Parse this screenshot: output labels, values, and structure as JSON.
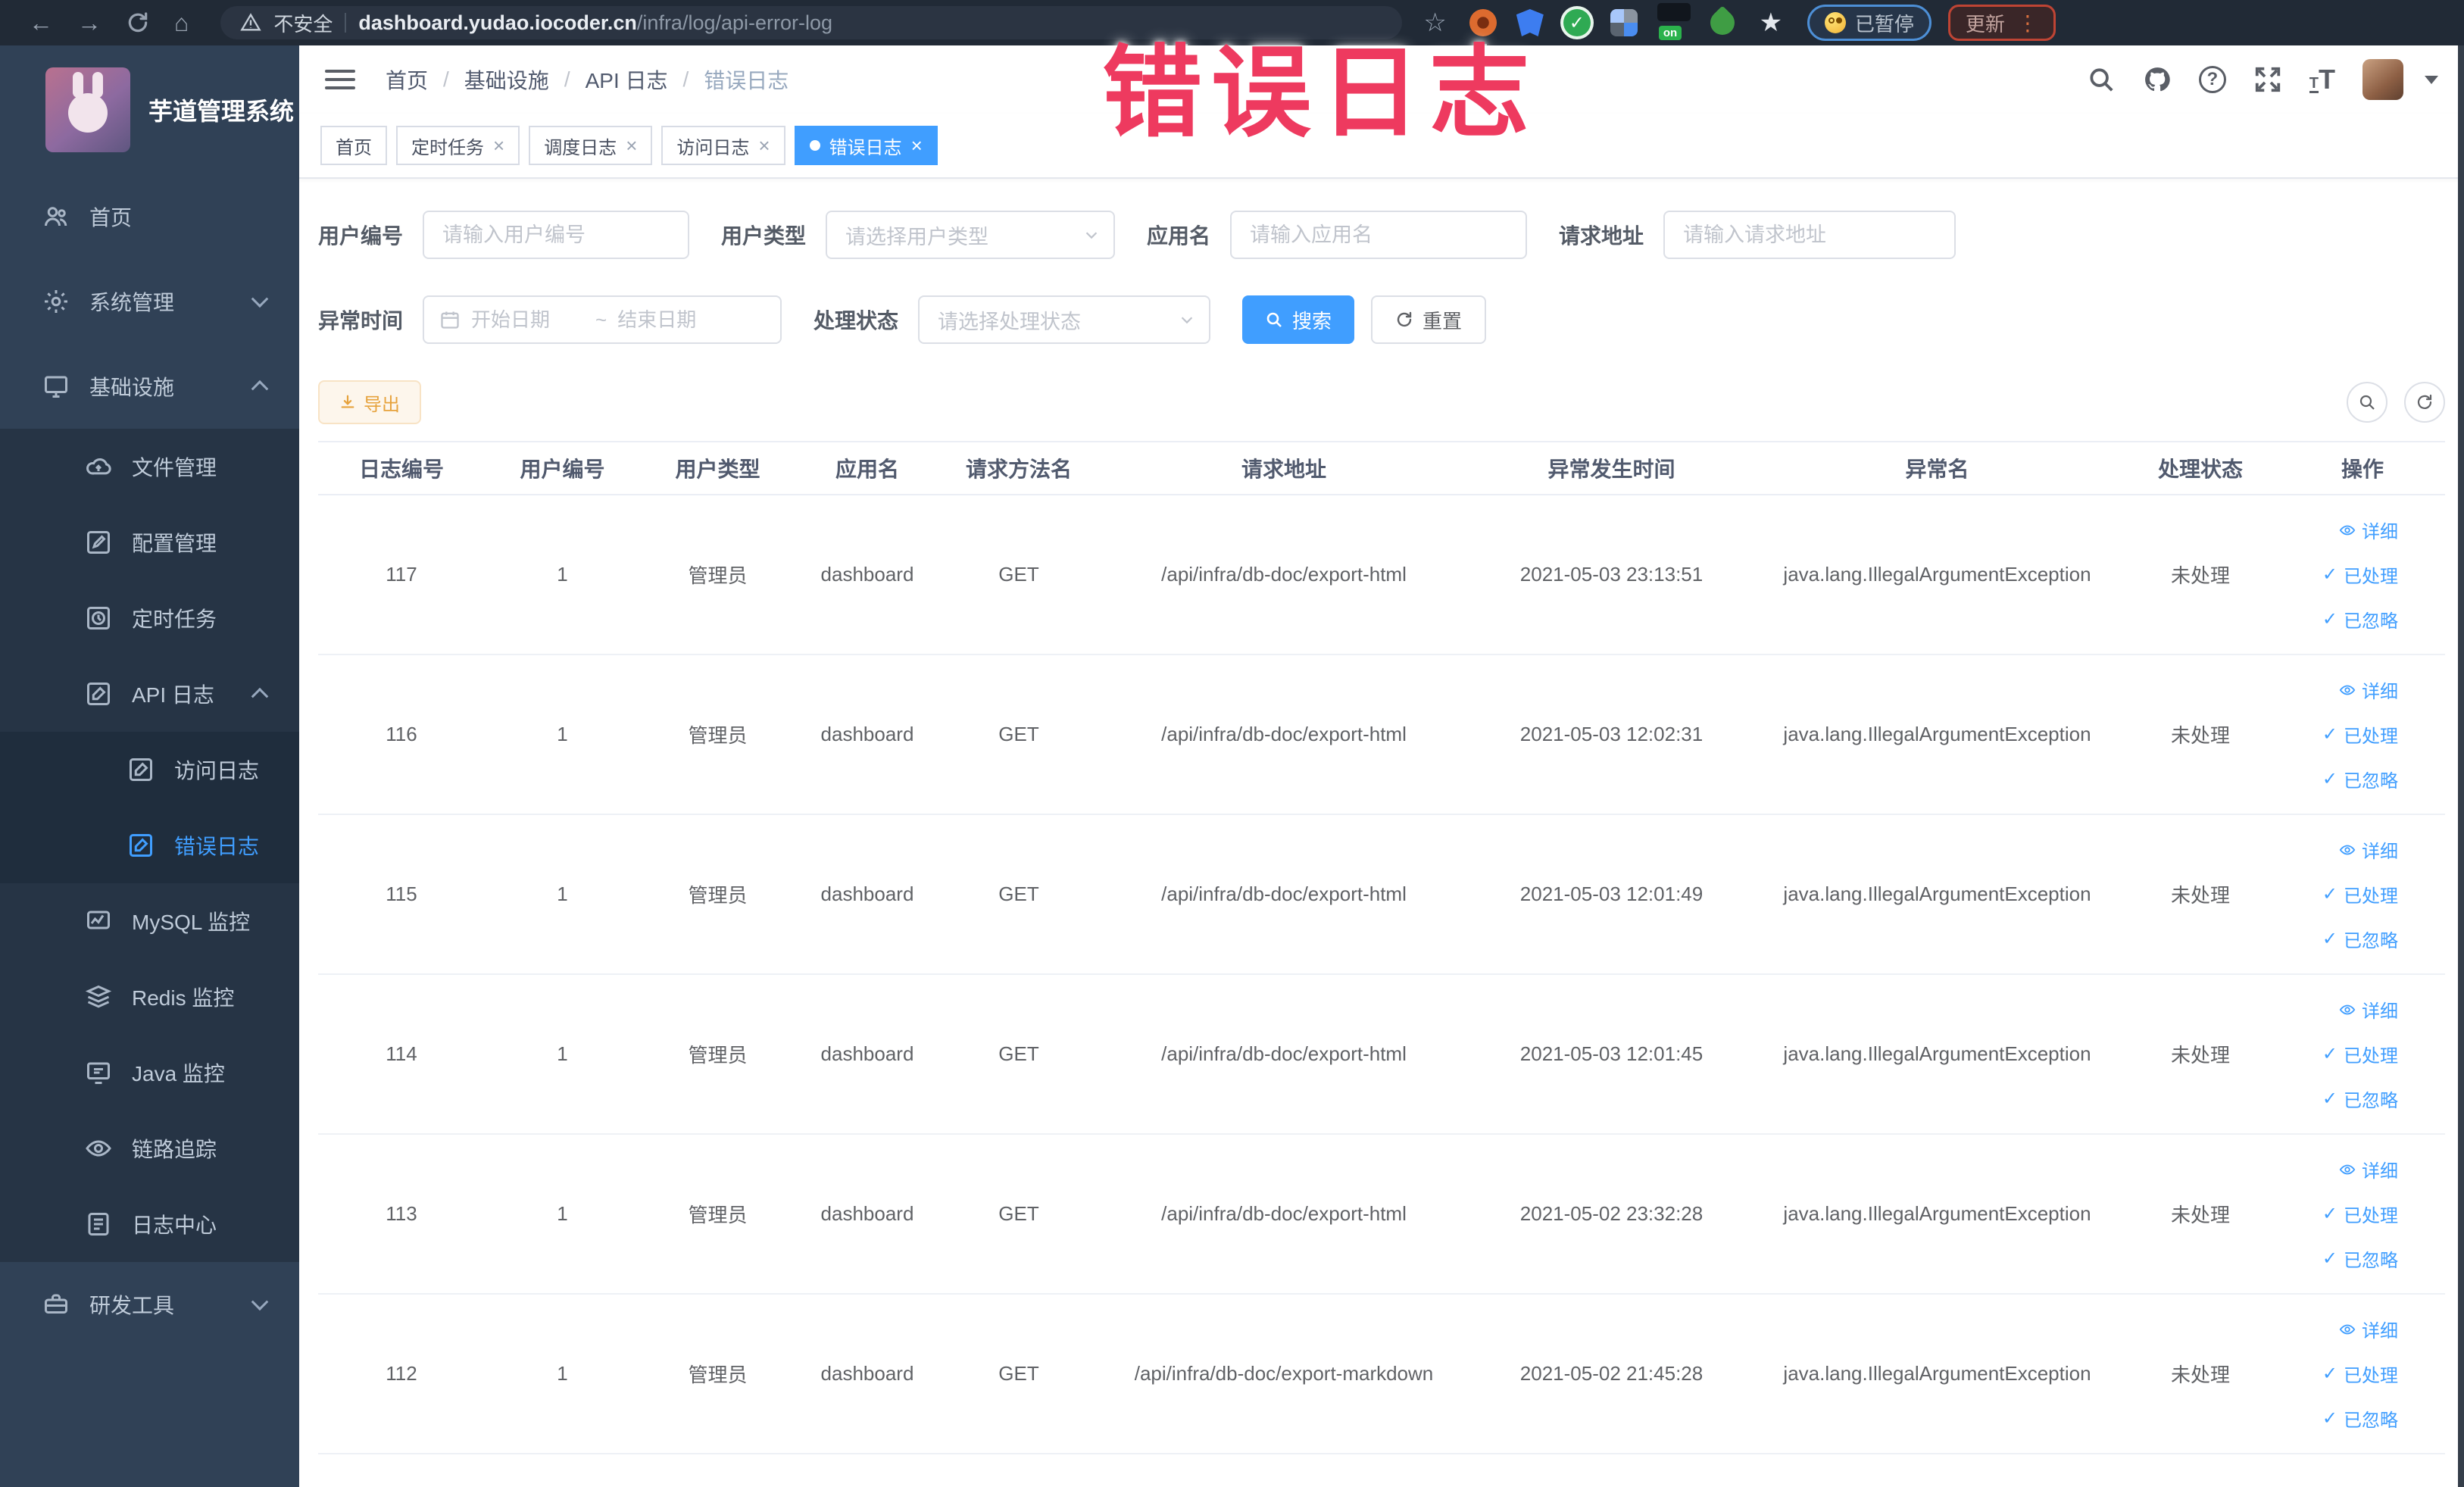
{
  "browser": {
    "security_label": "不安全",
    "url_domain": "dashboard.yudao.iocoder.cn",
    "url_path": "/infra/log/api-error-log",
    "paused_label": "已暂停",
    "update_label": "更新",
    "update_menu_dots": "⋮"
  },
  "overlay": {
    "title": "错误日志",
    "color": "#ee3a5f"
  },
  "sidebar": {
    "app_title": "芋道管理系统",
    "items": [
      {
        "label": "首页"
      },
      {
        "label": "系统管理"
      },
      {
        "label": "基础设施"
      },
      {
        "label": "文件管理"
      },
      {
        "label": "配置管理"
      },
      {
        "label": "定时任务"
      },
      {
        "label": "API 日志"
      },
      {
        "label": "访问日志"
      },
      {
        "label": "错误日志"
      },
      {
        "label": "MySQL 监控"
      },
      {
        "label": "Redis 监控"
      },
      {
        "label": "Java 监控"
      },
      {
        "label": "链路追踪"
      },
      {
        "label": "日志中心"
      },
      {
        "label": "研发工具"
      }
    ]
  },
  "header": {
    "breadcrumb": [
      "首页",
      "基础设施",
      "API 日志",
      "错误日志"
    ]
  },
  "tabs": [
    {
      "label": "首页"
    },
    {
      "label": "定时任务"
    },
    {
      "label": "调度日志"
    },
    {
      "label": "访问日志"
    },
    {
      "label": "错误日志"
    }
  ],
  "filters": {
    "user_id": {
      "label": "用户编号",
      "placeholder": "请输入用户编号"
    },
    "user_type": {
      "label": "用户类型",
      "placeholder": "请选择用户类型"
    },
    "app_name": {
      "label": "应用名",
      "placeholder": "请输入应用名"
    },
    "request_url": {
      "label": "请求地址",
      "placeholder": "请输入请求地址"
    },
    "exception_time": {
      "label": "异常时间",
      "start_placeholder": "开始日期",
      "separator": "~",
      "end_placeholder": "结束日期"
    },
    "process_status": {
      "label": "处理状态",
      "placeholder": "请选择处理状态"
    },
    "search_label": "搜索",
    "reset_label": "重置"
  },
  "toolbar": {
    "export_label": "导出"
  },
  "table": {
    "columns": [
      "日志编号",
      "用户编号",
      "用户类型",
      "应用名",
      "请求方法名",
      "请求地址",
      "异常发生时间",
      "异常名",
      "处理状态",
      "操作"
    ],
    "actions": [
      "详细",
      "已处理",
      "已忽略"
    ],
    "rows": [
      {
        "id": "117",
        "user_id": "1",
        "user_type": "管理员",
        "app": "dashboard",
        "method": "GET",
        "url": "/api/infra/db-doc/export-html",
        "time": "2021-05-03 23:13:51",
        "exception": "java.lang.IllegalArgumentException",
        "status": "未处理"
      },
      {
        "id": "116",
        "user_id": "1",
        "user_type": "管理员",
        "app": "dashboard",
        "method": "GET",
        "url": "/api/infra/db-doc/export-html",
        "time": "2021-05-03 12:02:31",
        "exception": "java.lang.IllegalArgumentException",
        "status": "未处理"
      },
      {
        "id": "115",
        "user_id": "1",
        "user_type": "管理员",
        "app": "dashboard",
        "method": "GET",
        "url": "/api/infra/db-doc/export-html",
        "time": "2021-05-03 12:01:49",
        "exception": "java.lang.IllegalArgumentException",
        "status": "未处理"
      },
      {
        "id": "114",
        "user_id": "1",
        "user_type": "管理员",
        "app": "dashboard",
        "method": "GET",
        "url": "/api/infra/db-doc/export-html",
        "time": "2021-05-03 12:01:45",
        "exception": "java.lang.IllegalArgumentException",
        "status": "未处理"
      },
      {
        "id": "113",
        "user_id": "1",
        "user_type": "管理员",
        "app": "dashboard",
        "method": "GET",
        "url": "/api/infra/db-doc/export-html",
        "time": "2021-05-02 23:32:28",
        "exception": "java.lang.IllegalArgumentException",
        "status": "未处理"
      },
      {
        "id": "112",
        "user_id": "1",
        "user_type": "管理员",
        "app": "dashboard",
        "method": "GET",
        "url": "/api/infra/db-doc/export-markdown",
        "time": "2021-05-02 21:45:28",
        "exception": "java.lang.IllegalArgumentException",
        "status": "未处理"
      }
    ]
  },
  "colors": {
    "accent": "#409eff",
    "overlay_pink": "#ee3a5f",
    "warning": "#e6a23c",
    "sidebar_bg": "#304156"
  }
}
